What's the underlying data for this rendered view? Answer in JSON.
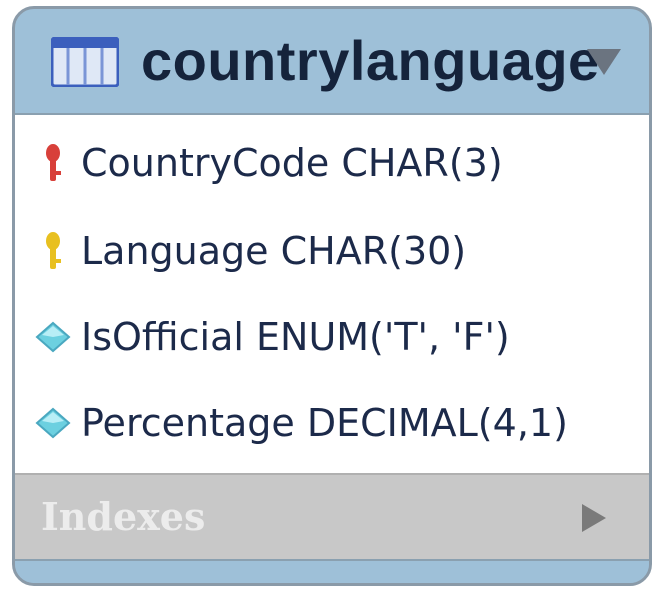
{
  "table": {
    "name": "countrylanguage",
    "colors": {
      "header": "#9ec0d8",
      "indexes_bar": "#c8c8c8",
      "primary_key": "#d8403a",
      "foreign_key": "#e8c020",
      "attribute": "#6cd0e0"
    },
    "columns": [
      {
        "label": "CountryCode CHAR(3)",
        "icon": "primary-key-icon"
      },
      {
        "label": "Language CHAR(30)",
        "icon": "key-icon"
      },
      {
        "label": "IsOfficial ENUM('T', 'F')",
        "icon": "diamond-icon"
      },
      {
        "label": "Percentage DECIMAL(4,1)",
        "icon": "diamond-icon"
      }
    ],
    "indexes_label": "Indexes"
  }
}
